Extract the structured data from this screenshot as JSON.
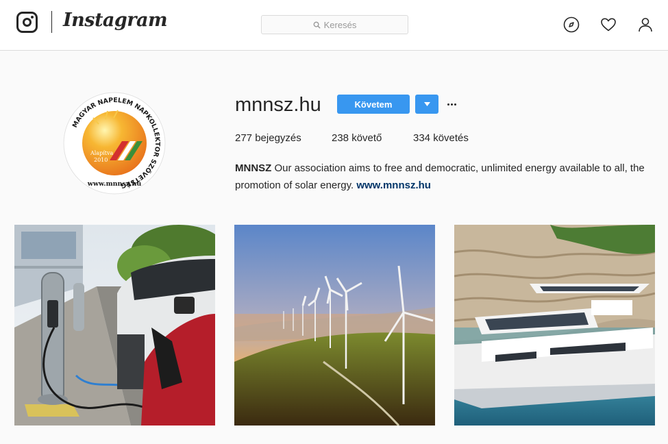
{
  "nav": {
    "brand": "Instagram",
    "search_placeholder": "Keresés"
  },
  "profile": {
    "username": "mnnsz.hu",
    "follow_label": "Követem",
    "avatar_ring_text": "MAGYAR NAPELEM NAPKOLLEKTOR SZÖVETSÉG",
    "avatar_founded": "Alapítva 2010",
    "avatar_url": "www.mnnsz.hu",
    "stats": {
      "posts_count": "277",
      "posts_label": "bejegyzés",
      "followers_count": "238",
      "followers_label": "követő",
      "following_count": "334",
      "following_label": "követés"
    },
    "bio_name": "MNNSZ",
    "bio_text": "Our association aims to free and democratic, unlimited energy available to all, the promotion of solar energy.",
    "bio_link": "www.mnnsz.hu"
  },
  "colors": {
    "follow_blue": "#3897f0",
    "link_navy": "#003569",
    "logo_orange": "#f39a1f",
    "flag_red": "#d3302f",
    "flag_green": "#3a8f3a"
  },
  "posts": [
    {
      "subject": "electric-car-charging"
    },
    {
      "subject": "wind-turbines-sunrise"
    },
    {
      "subject": "solar-yacht"
    }
  ]
}
